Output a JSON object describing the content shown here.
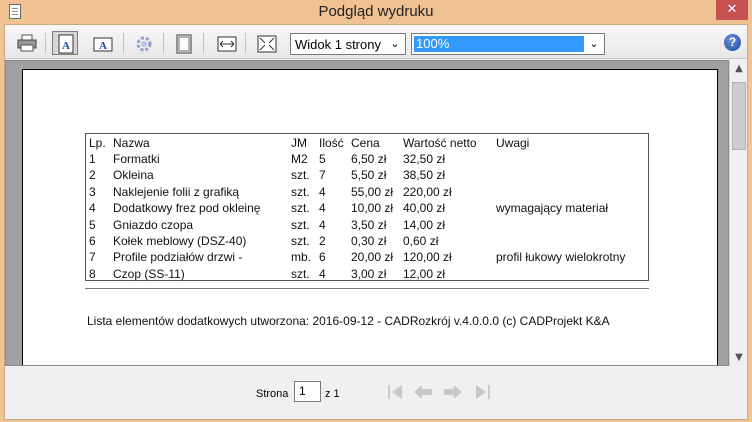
{
  "window": {
    "title": "Podgląd wydruku",
    "close": "✕"
  },
  "toolbar": {
    "view_select": "Widok 1 strony",
    "zoom_select": "100%",
    "help": "?"
  },
  "table": {
    "headers": [
      "Lp.",
      "Nazwa",
      "JM",
      "Ilość",
      "Cena",
      "Wartość netto",
      "Uwagi"
    ],
    "rows": [
      [
        "1",
        "Formatki",
        "M2",
        "5",
        "6,50 zł",
        "32,50 zł",
        ""
      ],
      [
        "2",
        "Okleina",
        "szt.",
        "7",
        "5,50 zł",
        "38,50 zł",
        ""
      ],
      [
        "3",
        "Naklejenie folii z grafiką",
        "szt.",
        "4",
        "55,00 zł",
        "220,00 zł",
        ""
      ],
      [
        "4",
        "Dodatkowy frez pod okleinę",
        "szt.",
        "4",
        "10,00 zł",
        "40,00 zł",
        "wymagający materiał"
      ],
      [
        "5",
        "Gniazdo czopa",
        "szt.",
        "4",
        "3,50 zł",
        "14,00 zł",
        ""
      ],
      [
        "6",
        "Kołek meblowy (DSZ-40)",
        "szt.",
        "2",
        "0,30 zł",
        "0,60 zł",
        ""
      ],
      [
        "7",
        "Profile podziałów drzwi -",
        "mb.",
        "6",
        "20,00 zł",
        "120,00 zł",
        "profil łukowy wielokrotny"
      ],
      [
        "8",
        "Czop (SS-11)",
        "szt.",
        "4",
        "3,00 zł",
        "12,00 zł",
        ""
      ]
    ]
  },
  "footer": "Lista elementów dodatkowych utworzona: 2016-09-12 - CADRozkrój v.4.0.0.0 (c) CADProjekt K&A",
  "nav": {
    "label": "Strona",
    "page": "1",
    "of": "z 1"
  }
}
